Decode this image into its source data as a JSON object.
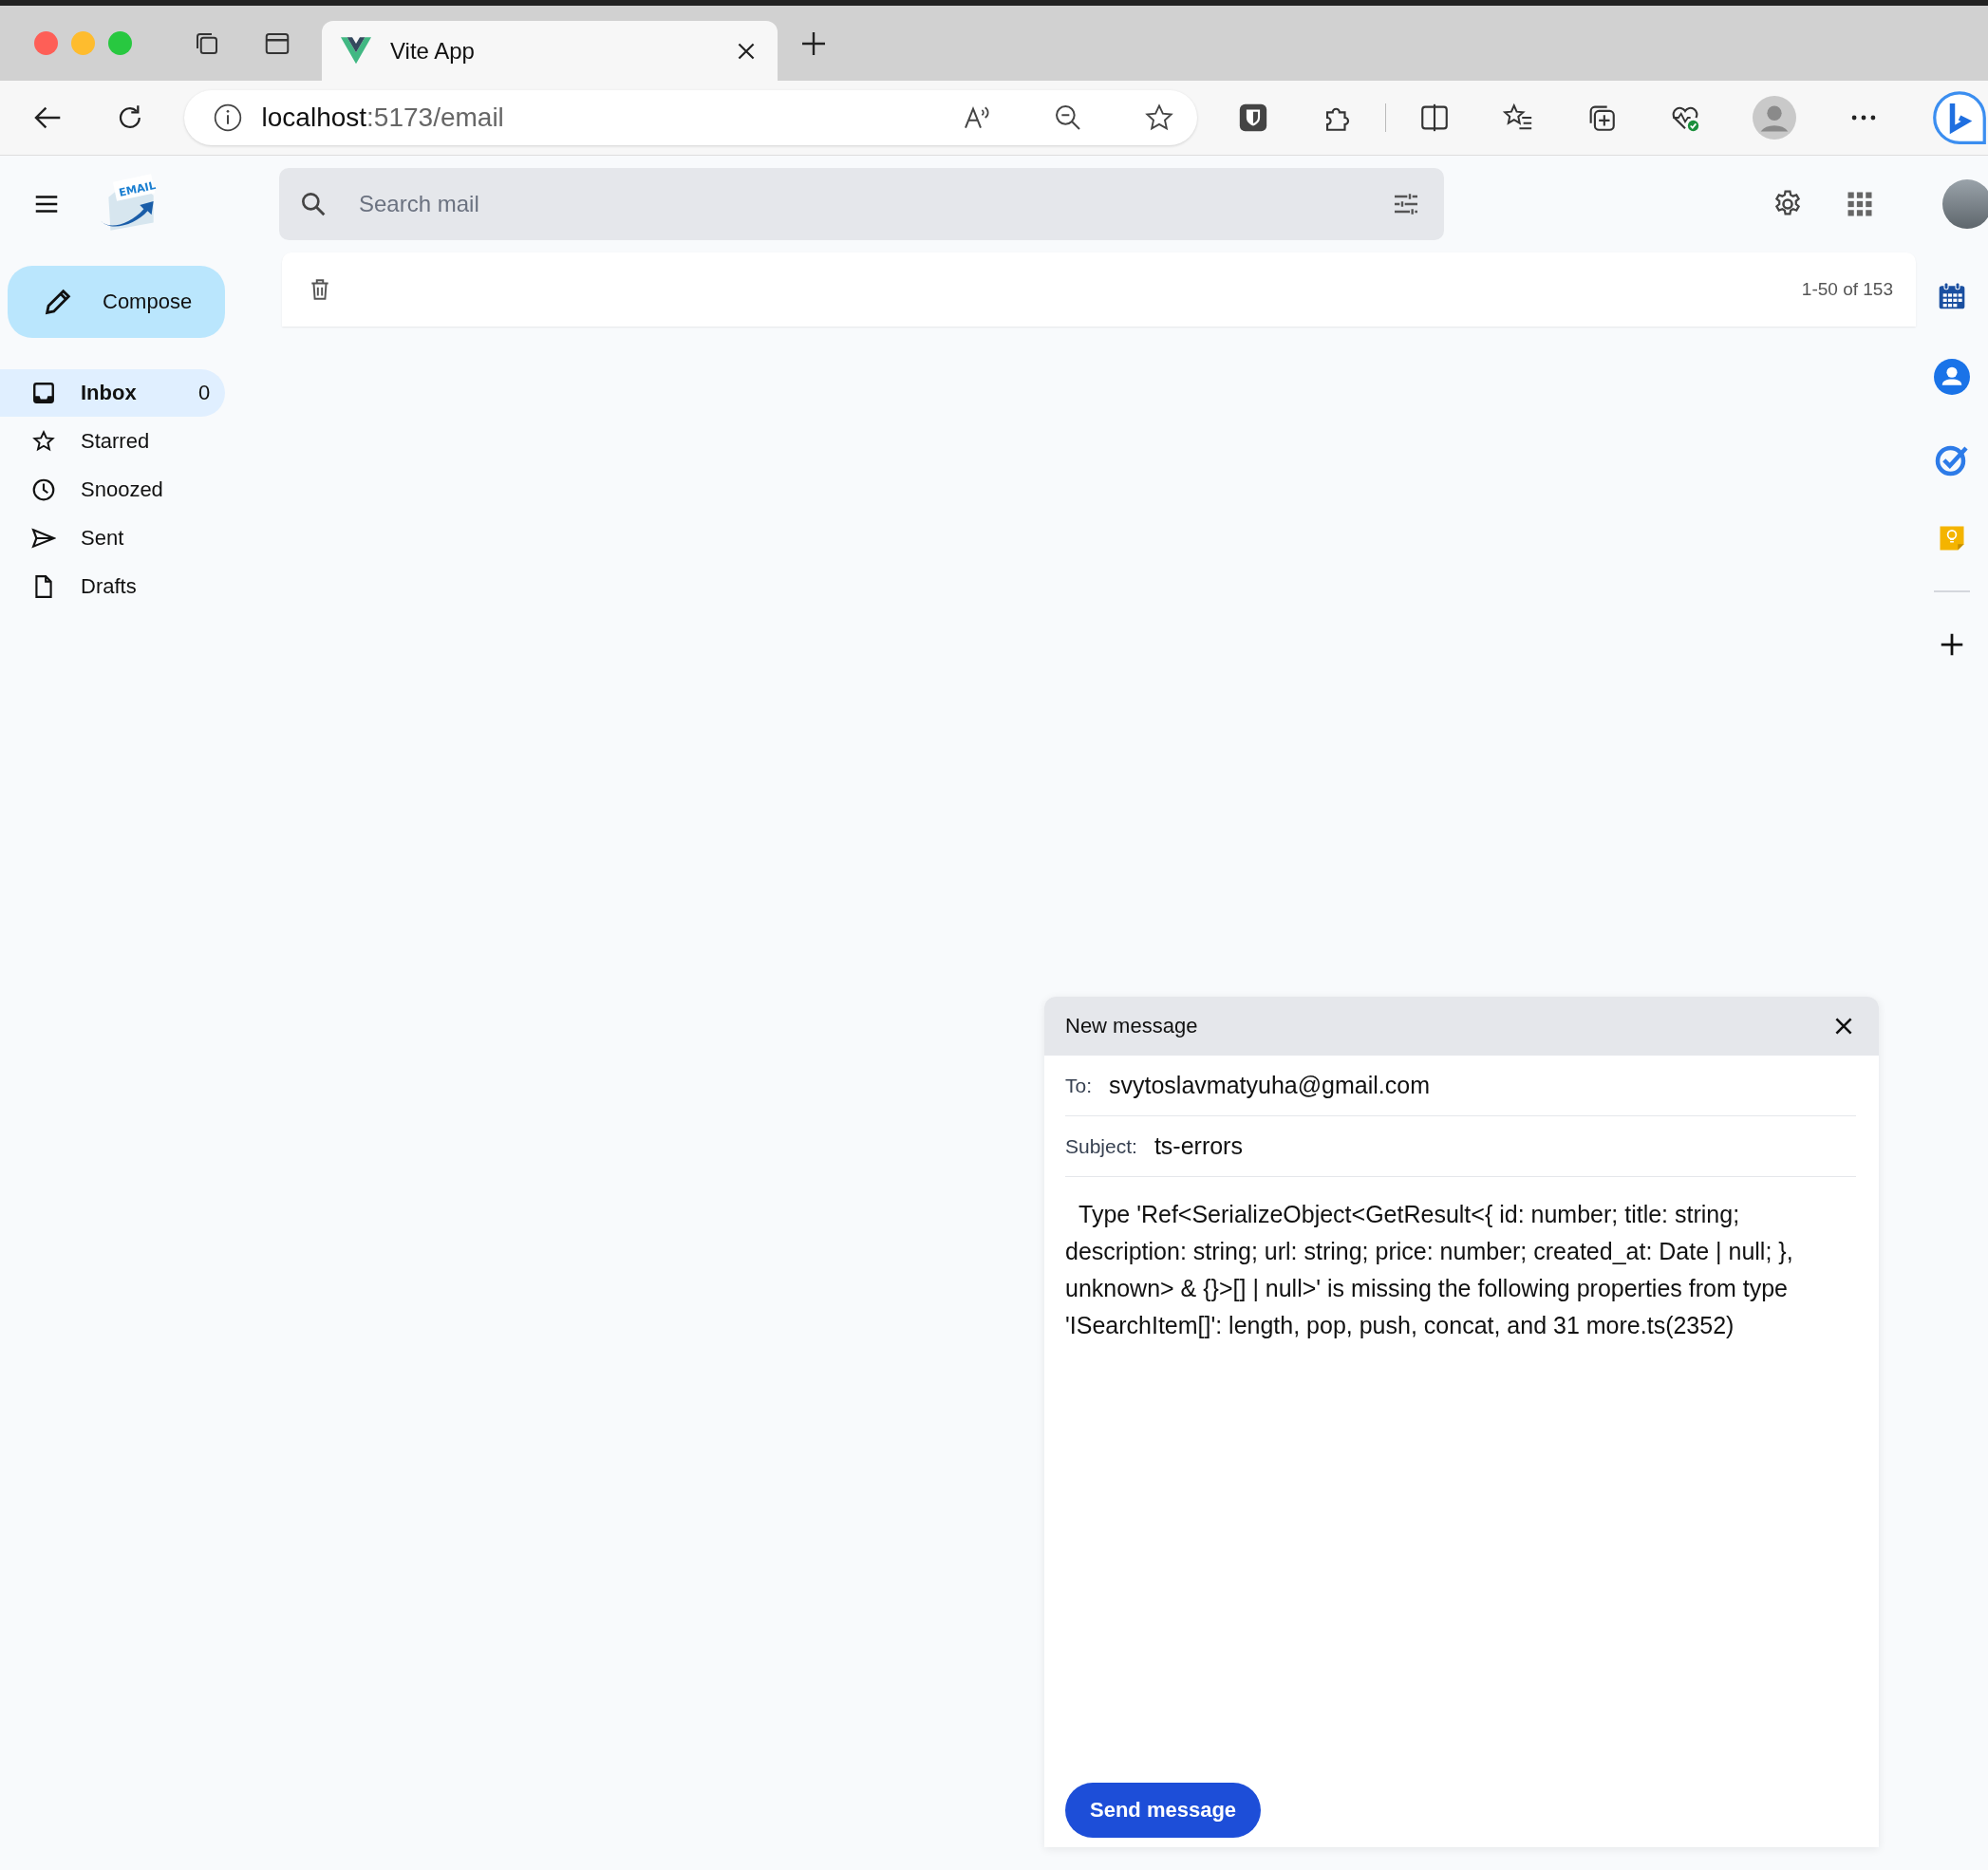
{
  "browser": {
    "tab_title": "Vite App",
    "url_host": "localhost",
    "url_path": ":5173/email"
  },
  "app": {
    "logo_text": "EMAIL",
    "search": {
      "placeholder": "Search mail"
    },
    "compose_label": "Compose",
    "nav": [
      {
        "label": "Inbox",
        "count": "0",
        "selected": true,
        "kind": "inbox"
      },
      {
        "label": "Starred",
        "selected": false,
        "kind": "star"
      },
      {
        "label": "Snoozed",
        "selected": false,
        "kind": "clock"
      },
      {
        "label": "Sent",
        "selected": false,
        "kind": "send"
      },
      {
        "label": "Drafts",
        "selected": false,
        "kind": "file"
      }
    ],
    "pagination": "1-50 of 153"
  },
  "compose": {
    "title": "New message",
    "to_label": "To:",
    "to": "svytoslavmatyuha@gmail.com",
    "subject_label": "Subject:",
    "subject": "ts-errors",
    "body": "Type 'Ref<SerializeObject<GetResult<{ id: number; title: string; description: string; url: string; price: number; created_at: Date | null; }, unknown> & {}>[] | null>' is missing the following properties from type 'ISearchItem[]': length, pop, push, concat, and 31 more.ts(2352)",
    "send_label": "Send message"
  }
}
